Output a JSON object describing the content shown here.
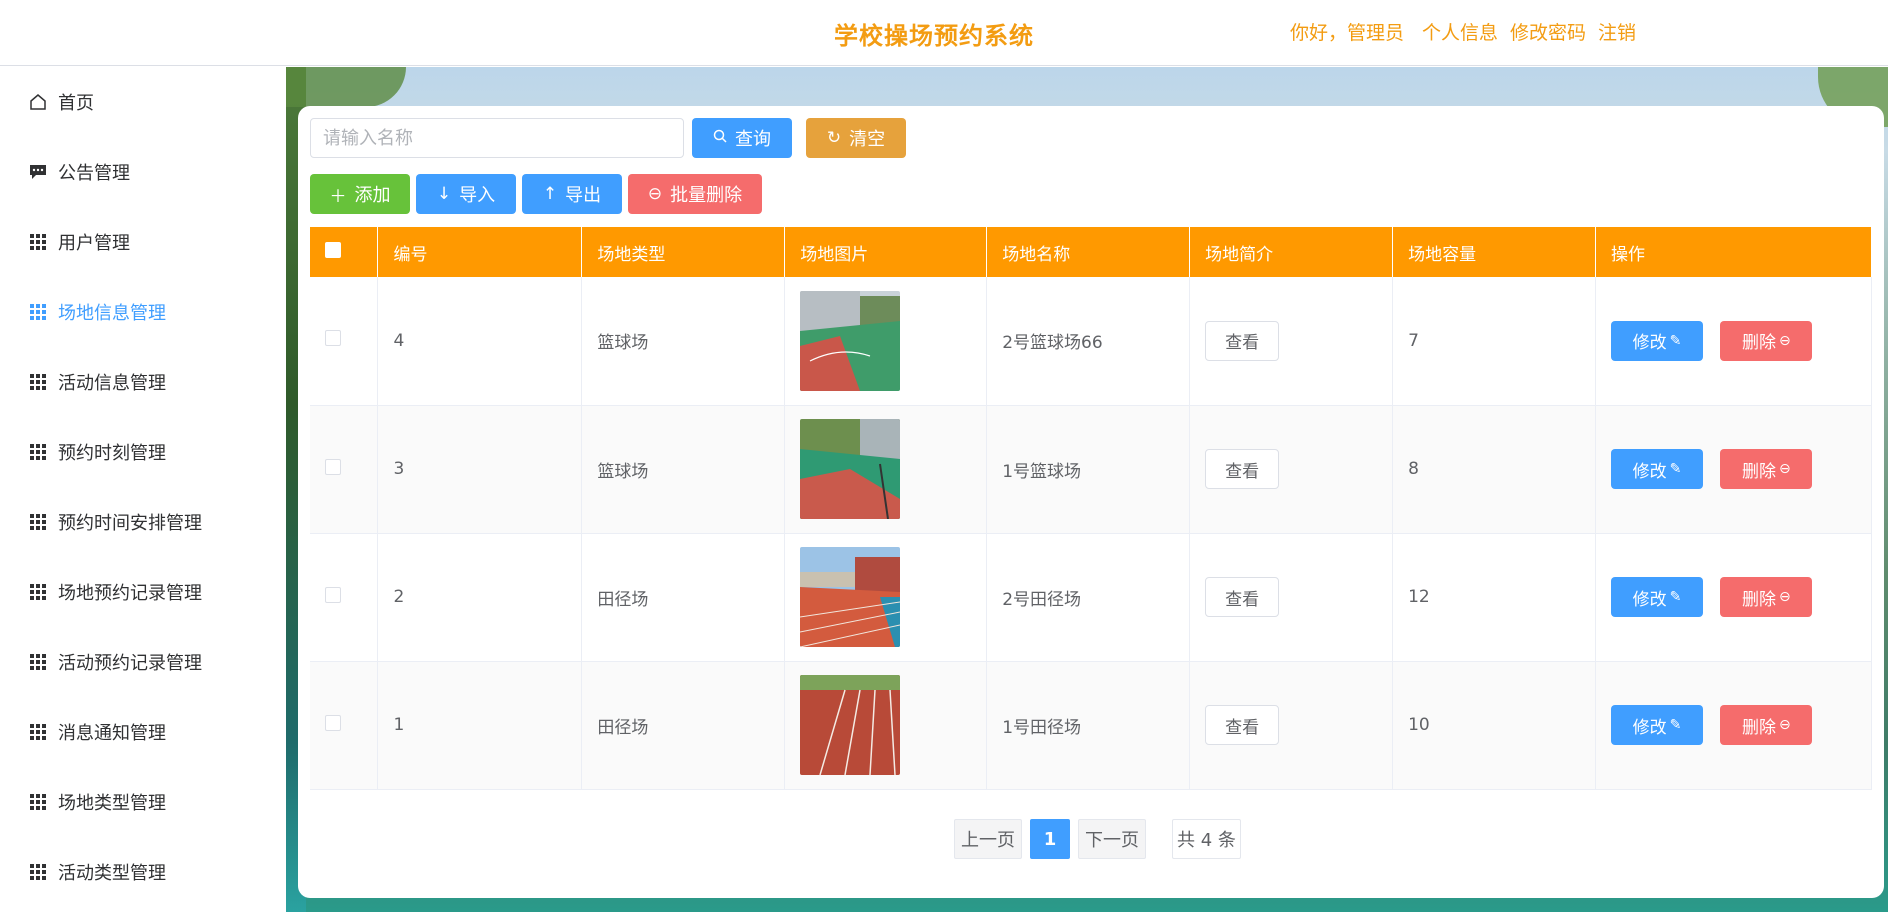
{
  "header": {
    "title": "学校操场预约系统",
    "greeting": "你好，管理员",
    "profile": "个人信息",
    "change_password": "修改密码",
    "logout": "注销"
  },
  "sidebar": {
    "items": [
      {
        "label": "首页",
        "icon": "home-icon"
      },
      {
        "label": "公告管理",
        "icon": "message-icon"
      },
      {
        "label": "用户管理",
        "icon": "grid-icon"
      },
      {
        "label": "场地信息管理",
        "icon": "grid-icon",
        "active": true
      },
      {
        "label": "活动信息管理",
        "icon": "grid-icon"
      },
      {
        "label": "预约时刻管理",
        "icon": "grid-icon"
      },
      {
        "label": "预约时间安排管理",
        "icon": "grid-icon"
      },
      {
        "label": "场地预约记录管理",
        "icon": "grid-icon"
      },
      {
        "label": "活动预约记录管理",
        "icon": "grid-icon"
      },
      {
        "label": "消息通知管理",
        "icon": "grid-icon"
      },
      {
        "label": "场地类型管理",
        "icon": "grid-icon"
      },
      {
        "label": "活动类型管理",
        "icon": "grid-icon"
      }
    ]
  },
  "toolbar": {
    "search_placeholder": "请输入名称",
    "query": "查询",
    "clear": "清空",
    "add": "添加",
    "import": "导入",
    "export": "导出",
    "batch_delete": "批量删除"
  },
  "table": {
    "headers": [
      "编号",
      "场地类型",
      "场地图片",
      "场地名称",
      "场地简介",
      "场地容量",
      "操作"
    ],
    "rows": [
      {
        "id": "4",
        "type": "篮球场",
        "name": "2号篮球场66",
        "view": "查看",
        "capacity": "7",
        "edit": "修改",
        "delete": "删除"
      },
      {
        "id": "3",
        "type": "篮球场",
        "name": "1号篮球场",
        "view": "查看",
        "capacity": "8",
        "edit": "修改",
        "delete": "删除"
      },
      {
        "id": "2",
        "type": "田径场",
        "name": "2号田径场",
        "view": "查看",
        "capacity": "12",
        "edit": "修改",
        "delete": "删除"
      },
      {
        "id": "1",
        "type": "田径场",
        "name": "1号田径场",
        "view": "查看",
        "capacity": "10",
        "edit": "修改",
        "delete": "删除"
      }
    ]
  },
  "pagination": {
    "prev": "上一页",
    "current": "1",
    "next": "下一页",
    "total": "共 4 条"
  },
  "colors": {
    "accent": "#f39c12",
    "header_bg": "#ff9900",
    "primary": "#409eff",
    "success": "#67c23a",
    "warning": "#e6a23c",
    "danger": "#f56c6c"
  }
}
